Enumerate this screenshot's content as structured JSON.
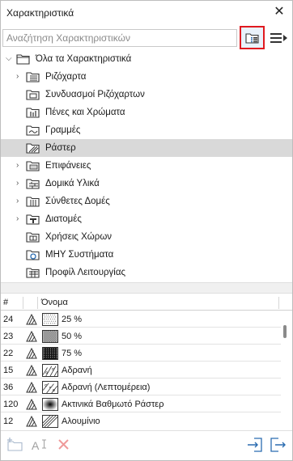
{
  "window": {
    "title": "Χαρακτηριστικά",
    "close_glyph": "✕"
  },
  "search": {
    "placeholder": "Αναζήτηση Χαρακτηριστικών",
    "value": ""
  },
  "toolbar": {
    "view_button_icon": "folder-list-view-icon",
    "menu_button_icon": "list-menu-icon",
    "highlight_color": "#e0191f"
  },
  "tree": {
    "root": {
      "label": "Όλα τα Χαρακτηριστικά",
      "expanded": true
    },
    "items": [
      {
        "label": "Ριζόχαρτα",
        "expandable": true
      },
      {
        "label": "Συνδυασμοί Ριζόχαρτων",
        "expandable": false
      },
      {
        "label": "Πένες και Χρώματα",
        "expandable": false
      },
      {
        "label": "Γραμμές",
        "expandable": false
      },
      {
        "label": "Ράστερ",
        "expandable": false,
        "selected": true
      },
      {
        "label": "Επιφάνειες",
        "expandable": true
      },
      {
        "label": "Δομικά Υλικά",
        "expandable": true
      },
      {
        "label": "Σύνθετες Δομές",
        "expandable": true
      },
      {
        "label": "Διατομές",
        "expandable": true
      },
      {
        "label": "Χρήσεις Χώρων",
        "expandable": false
      },
      {
        "label": "ΜΗΥ Συστήματα",
        "expandable": false
      },
      {
        "label": "Προφίλ Λειτουργίας",
        "expandable": false
      }
    ]
  },
  "table": {
    "columns": {
      "number": "#",
      "name": "Όνομα"
    },
    "rows": [
      {
        "num": "24",
        "name": "25 %",
        "pattern": "dots-light"
      },
      {
        "num": "23",
        "name": "50 %",
        "pattern": "dots-medium"
      },
      {
        "num": "22",
        "name": "75 %",
        "pattern": "dots-dark"
      },
      {
        "num": "15",
        "name": "Αδρανή",
        "pattern": "gravel"
      },
      {
        "num": "36",
        "name": "Αδρανή (Λεπτομέρεια)",
        "pattern": "gravel-detail"
      },
      {
        "num": "120",
        "name": "Ακτινικά Βαθμωτό Ράστερ",
        "pattern": "radial-gradient"
      },
      {
        "num": "12",
        "name": "Αλουμίνιο",
        "pattern": "diagonal"
      }
    ]
  },
  "footer": {
    "buttons": [
      "new-folder-icon",
      "rename-icon",
      "delete-icon",
      "import-icon",
      "export-icon"
    ]
  },
  "colors": {
    "selected_row": "#d9d9d9",
    "icon_blue": "#2b6cb0",
    "icon_red": "#e04545"
  }
}
